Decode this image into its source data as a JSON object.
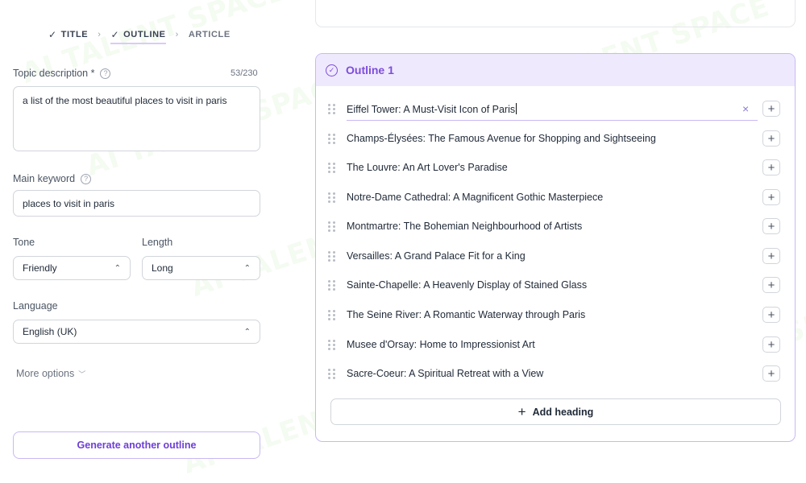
{
  "watermark": "AI TALENT SPACE",
  "steps": [
    {
      "label": "TITLE",
      "state": "done"
    },
    {
      "label": "OUTLINE",
      "state": "active"
    },
    {
      "label": "ARTICLE",
      "state": "pending"
    }
  ],
  "form": {
    "topic_label": "Topic description *",
    "topic_counter": "53/230",
    "topic_value": "a list of the most beautiful places to visit in paris",
    "keyword_label": "Main keyword",
    "keyword_value": "places to visit in paris",
    "tone_label": "Tone",
    "tone_value": "Friendly",
    "length_label": "Length",
    "length_value": "Long",
    "language_label": "Language",
    "language_value": "English (UK)",
    "more_options": "More options",
    "generate_button": "Generate another outline"
  },
  "outline": {
    "title": "Outline 1",
    "headings": [
      "Eiffel Tower: A Must-Visit Icon of Paris",
      "Champs-Élysées: The Famous Avenue for Shopping and Sightseeing",
      "The Louvre: An Art Lover's Paradise",
      "Notre-Dame Cathedral: A Magnificent Gothic Masterpiece",
      "Montmartre: The Bohemian Neighbourhood of Artists",
      "Versailles: A Grand Palace Fit for a King",
      "Sainte-Chapelle: A Heavenly Display of Stained Glass",
      "The Seine River: A Romantic Waterway through Paris",
      "Musee d'Orsay: Home to Impressionist Art",
      "Sacre-Coeur: A Spiritual Retreat with a View"
    ],
    "add_heading": "Add heading"
  },
  "icons": {
    "check": "✓",
    "chevron_right": "›",
    "help": "?",
    "select_caret": "⌃⌄",
    "chevron_down": "⌄",
    "plus": "+",
    "clear": "×"
  },
  "colors": {
    "accent": "#7c4ddc",
    "accent_light": "#efe9fd",
    "border_accent": "#c9b8f5"
  }
}
